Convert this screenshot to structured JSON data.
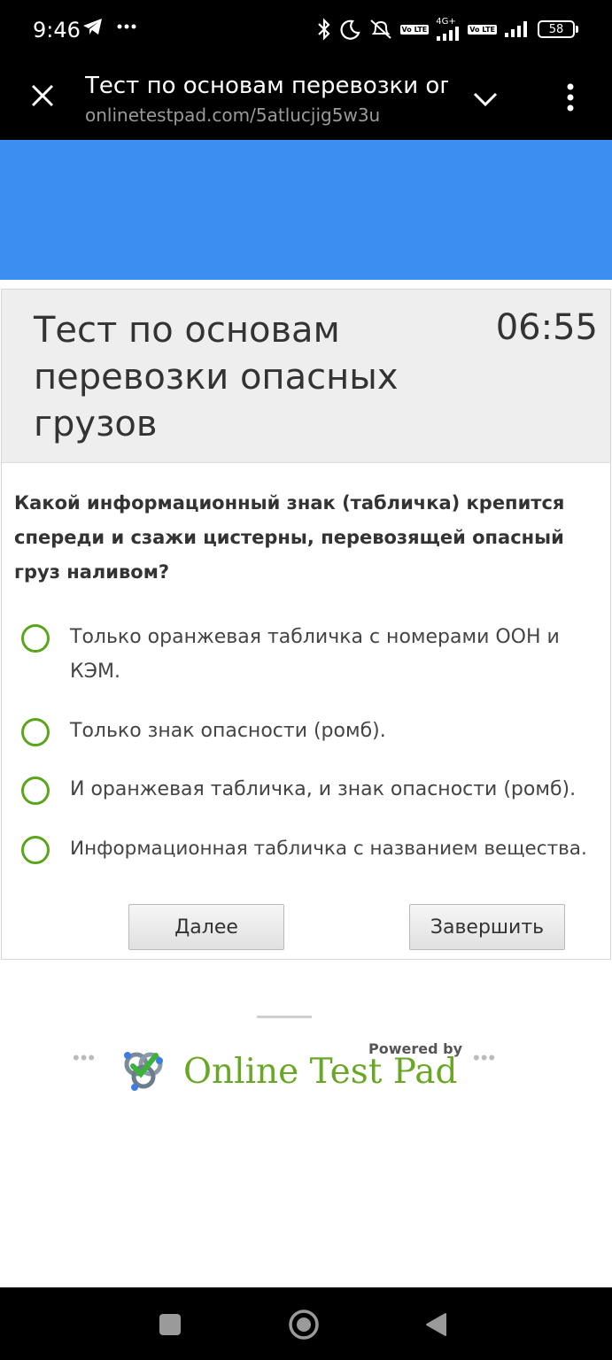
{
  "status_bar": {
    "time": "9:46",
    "network": "4G+",
    "volte": "Vo LTE",
    "battery": "58"
  },
  "browser": {
    "title": "Тест по основам перевозки оп",
    "url": "onlinetestpad.com/5atlucjig5w3u"
  },
  "test": {
    "title": "Тест по основам перевозки опасных грузов",
    "timer": "06:55",
    "question": "Какой информационный знак (табличка) крепится спереди и сзажи цистерны, перевозящей опасный груз наливом?",
    "options": [
      {
        "label": "Только оранжевая табличка с номерами ООН и КЭМ."
      },
      {
        "label": "Только знак опасности (ромб)."
      },
      {
        "label": "И оранжевая табличка, и знак опасности (ромб)."
      },
      {
        "label": "Информационная табличка с названием вещества."
      }
    ],
    "next_label": "Далее",
    "finish_label": "Завершить"
  },
  "footer": {
    "powered_by": "Powered by",
    "brand": "Online Test Pad",
    "dots": "•••"
  },
  "colors": {
    "banner": "#3b8ff0",
    "radio": "#5aa51c",
    "brand": "#6ba727"
  },
  "icons": [
    "telegram-icon",
    "more-dots-icon",
    "bluetooth-icon",
    "moon-icon",
    "alarm-off-icon",
    "signal-icon",
    "battery-icon",
    "close-icon",
    "chevron-down-icon",
    "kebab-menu-icon",
    "square-icon",
    "circle-home-icon",
    "back-triangle-icon"
  ]
}
